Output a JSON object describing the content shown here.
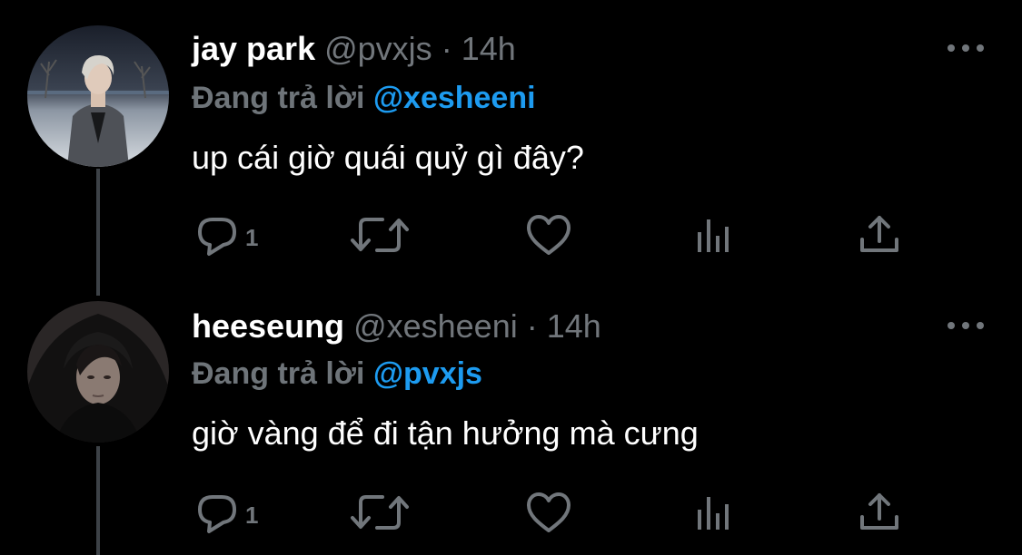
{
  "colors": {
    "background": "#000000",
    "primary_text": "#ffffff",
    "secondary_text": "#71767b",
    "mention": "#1d9bf0",
    "thread_line": "#3d4247"
  },
  "tweets": [
    {
      "display_name": "jay park",
      "handle": "@pvxjs",
      "separator": "·",
      "time": "14h",
      "reply_prefix": "Đang trả lời",
      "reply_to": "@xesheeni",
      "text": "up cái giờ quái quỷ gì đây?",
      "reply_count": "1",
      "icons": {
        "reply": "reply-icon",
        "retweet": "retweet-icon",
        "like": "like-icon",
        "analytics": "analytics-icon",
        "share": "share-icon",
        "more": "more-icon"
      }
    },
    {
      "display_name": "heeseung",
      "handle": "@xesheeni",
      "separator": "·",
      "time": "14h",
      "reply_prefix": "Đang trả lời",
      "reply_to": "@pvxjs",
      "text": "giờ vàng để đi tận hưởng mà cưng",
      "reply_count": "1",
      "icons": {
        "reply": "reply-icon",
        "retweet": "retweet-icon",
        "like": "like-icon",
        "analytics": "analytics-icon",
        "share": "share-icon",
        "more": "more-icon"
      }
    }
  ]
}
